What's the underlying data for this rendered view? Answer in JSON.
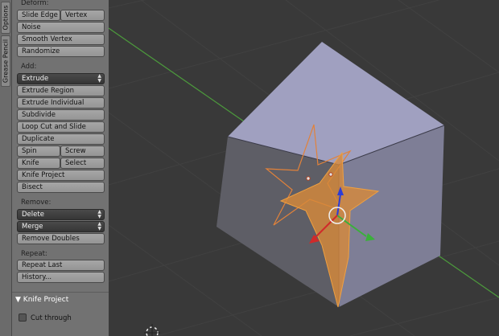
{
  "tabs": [
    {
      "label": "Options"
    },
    {
      "label": "Grease Pencil"
    }
  ],
  "toolshelf": {
    "deform": {
      "title": "Deform:",
      "slide_edge": "Slide Edge",
      "vertex": "Vertex",
      "noise": "Noise",
      "smooth_vertex": "Smooth Vertex",
      "randomize": "Randomize"
    },
    "add": {
      "title": "Add:",
      "extrude_select": "Extrude",
      "extrude_region": "Extrude Region",
      "extrude_individual": "Extrude Individual",
      "subdivide": "Subdivide",
      "loop_cut": "Loop Cut and Slide",
      "duplicate": "Duplicate",
      "spin": "Spin",
      "screw": "Screw",
      "knife": "Knife",
      "select": "Select",
      "knife_project": "Knife Project",
      "bisect": "Bisect"
    },
    "remove": {
      "title": "Remove:",
      "delete_select": "Delete",
      "merge_select": "Merge",
      "remove_doubles": "Remove Doubles"
    },
    "repeat": {
      "title": "Repeat:",
      "repeat_last": "Repeat Last",
      "history": "History..."
    }
  },
  "operator_panel": {
    "title": "Knife Project",
    "cut_through_label": "Cut through",
    "cut_through_checked": false
  },
  "colors": {
    "viewport_bg": "#393939",
    "cube_top": "#a0a0c0",
    "cube_left": "#5e5e66",
    "cube_right": "#7e7e96",
    "selection_orange": "#f09a3a",
    "x_axis_green": "#4c9a3c"
  }
}
